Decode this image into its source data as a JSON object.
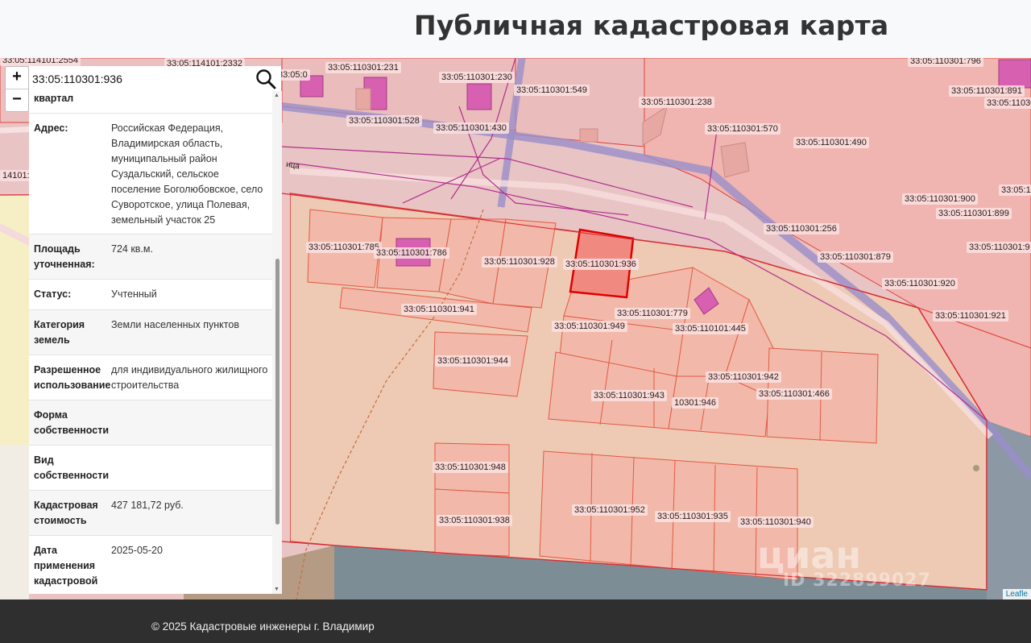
{
  "header": {
    "title": "Публичная кадастровая карта"
  },
  "search": {
    "value": "33:05:110301:936"
  },
  "zoom": {
    "in": "+",
    "out": "−"
  },
  "panel": {
    "partial_label": "квартал",
    "rows": [
      {
        "key": "Адрес:",
        "value": "Российская Федерация, Владимирская область, муниципальный район Суздальский, сельское поселение Боголюбовское, село Суворотское, улица Полевая, земельный участок 25"
      },
      {
        "key": "Площадь уточненная:",
        "value": "724 кв.м."
      },
      {
        "key": "Статус:",
        "value": "Учтенный"
      },
      {
        "key": "Категория земель",
        "value": "Земли населенных пунктов"
      },
      {
        "key": "Разрешенное использование",
        "value": "для индивидуального жилищного строительства"
      },
      {
        "key": "Форма собственности",
        "value": ""
      },
      {
        "key": "Вид собственности",
        "value": ""
      },
      {
        "key": "Кадастровая стоимость",
        "value": "427 181,72 руб."
      },
      {
        "key": "Дата применения кадастровой",
        "value": "2025-05-20"
      }
    ]
  },
  "map": {
    "street_label": "ица",
    "labels": [
      "33:05:114101:2554",
      "33:05:114101:2332",
      "33:05:0",
      "33:05:110301:231",
      "33:05:110301:230",
      "33:05:110301:549",
      "33:05:110301:796",
      "33:05:110301:891",
      "33:05:11030",
      "33:05:110301:238",
      "33:05:110301:528",
      "33:05:110301:430",
      "33:05:110301:570",
      "33:05:110301:490",
      "14101:3",
      "33:05:110301:900",
      "33:05:110301:899",
      "33:05:1",
      "33:05:110301:256",
      "33:05:110301:785",
      "33:05:110301:786",
      "33:05:110301:928",
      "33:05:110301:936",
      "33:05:110301:879",
      "33:05:110301:9",
      "33:05:110301:920",
      "33:05:110301:779",
      "33:05:110301:941",
      "33:05:110301:949",
      "33:05:110101:445",
      "33:05:110301:921",
      "33:05:110301:944",
      "33:05:110301:942",
      "33:05:110301:943",
      "10301:946",
      "33:05:110301:466",
      "33:05:110301:948",
      "33:05:110301:952",
      "33:05:110301:935",
      "33:05:110301:940",
      "33:05:110301:938"
    ],
    "attribution": "Leafle",
    "watermark": "циан",
    "watermark_id": "ID 322899027",
    "colors": {
      "parcel_fill": "#f2c0b4",
      "parcel_border": "#e0423a",
      "road": "#9a8fc9",
      "selected": "#f08a80"
    }
  },
  "footer": {
    "text": "© 2025 Кадастровые инженеры г. Владимир"
  }
}
